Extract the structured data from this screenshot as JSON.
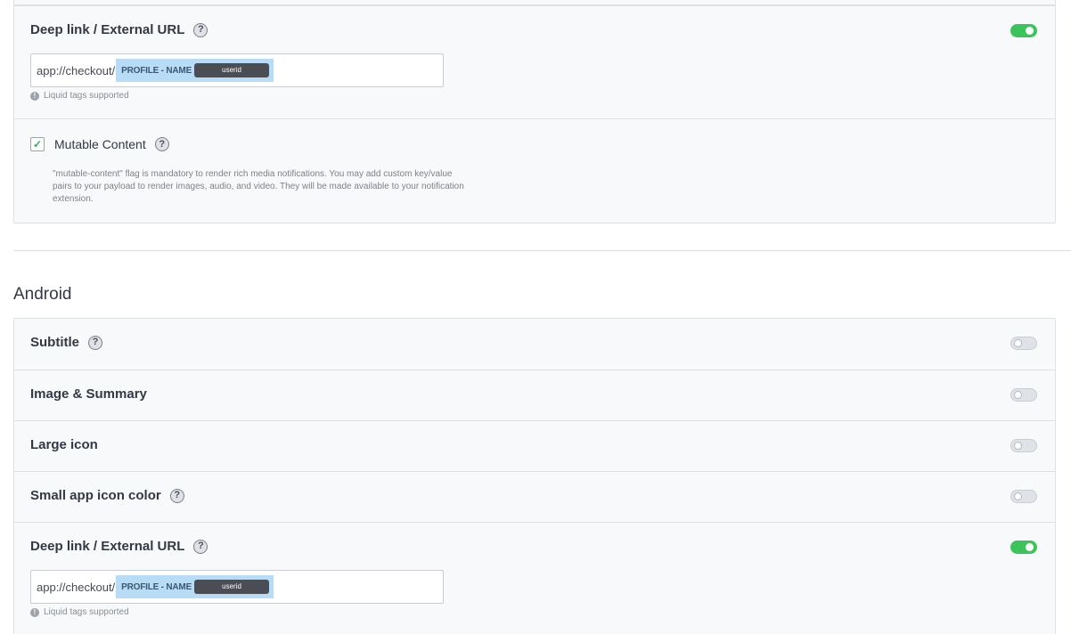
{
  "ios_card": {
    "deeplink": {
      "title": "Deep link / External URL",
      "help": "?",
      "enabled": true,
      "url_prefix": "app://checkout/",
      "tag_name": "PROFILE - NAME",
      "tag_value": "userid",
      "hint_icon": "!",
      "hint": "Liquid tags supported"
    },
    "mutable": {
      "checked": true,
      "check_mark": "✓",
      "label": "Mutable Content",
      "help": "?",
      "description": "\"mutable-content\" flag is mandatory to render rich media notifications. You may add custom key/value pairs to your payload to render images, audio, and video. They will be made available to your notification extension."
    }
  },
  "android": {
    "section_title": "Android",
    "rows": [
      {
        "title": "Subtitle",
        "help": "?",
        "enabled": false
      },
      {
        "title": "Image & Summary",
        "enabled": false
      },
      {
        "title": "Large icon",
        "enabled": false
      },
      {
        "title": "Small app icon color",
        "help": "?",
        "enabled": false
      }
    ],
    "deeplink": {
      "title": "Deep link / External URL",
      "help": "?",
      "enabled": true,
      "url_prefix": "app://checkout/",
      "tag_name": "PROFILE - NAME",
      "tag_value": "userid",
      "hint_icon": "!",
      "hint": "Liquid tags supported"
    }
  },
  "colors": {
    "toggle_on": "#3cc45c",
    "toggle_off": "#dfe2e6",
    "tag_bg": "#b9dcf6",
    "card_bg": "#f8f9fa"
  }
}
